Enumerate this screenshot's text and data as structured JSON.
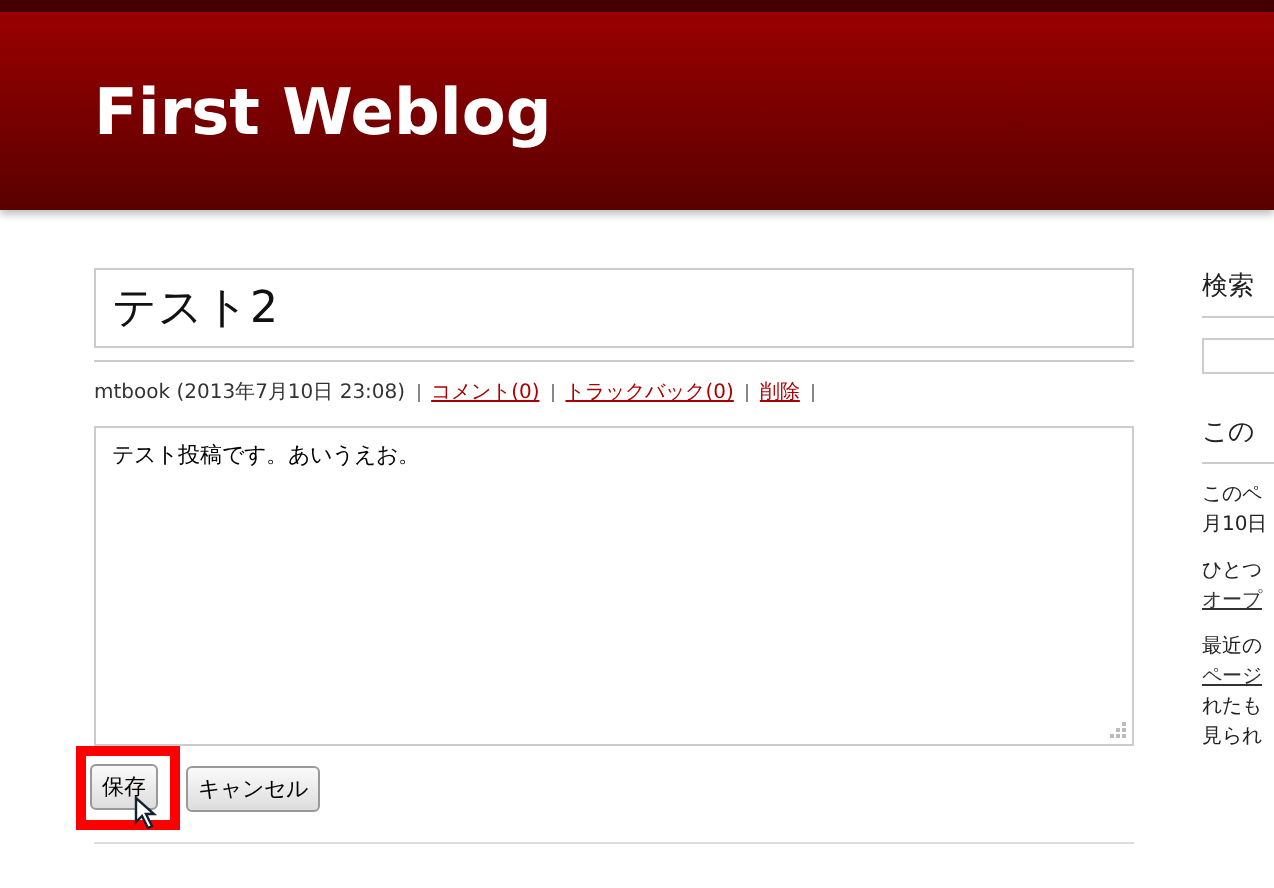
{
  "header": {
    "title": "First Weblog"
  },
  "entry": {
    "title": "テスト2",
    "meta": "mtbook (2013年7月10日 23:08)",
    "links": [
      {
        "label": "コメント(0)"
      },
      {
        "label": "トラックバック(0)"
      },
      {
        "label": "削除"
      }
    ],
    "body": "テスト投稿です。あいうえお。",
    "buttons": [
      {
        "label": "保存",
        "highlighted": true
      },
      {
        "label": "キャンセル",
        "highlighted": false
      }
    ]
  },
  "sidebar": {
    "search_heading": "検索",
    "section_heading": "この",
    "paragraphs": [
      [
        {
          "text": "このペ",
          "link": false
        },
        {
          "text": "月10日",
          "link": false
        }
      ],
      [
        {
          "text": "ひとつ",
          "link": false
        },
        {
          "text": "オープ",
          "link": true
        }
      ],
      [
        {
          "text": "最近の",
          "link": false
        },
        {
          "text": "ページ",
          "link": true
        },
        {
          "text": "れたも",
          "link": false
        },
        {
          "text": "見られ",
          "link": false
        }
      ]
    ]
  }
}
